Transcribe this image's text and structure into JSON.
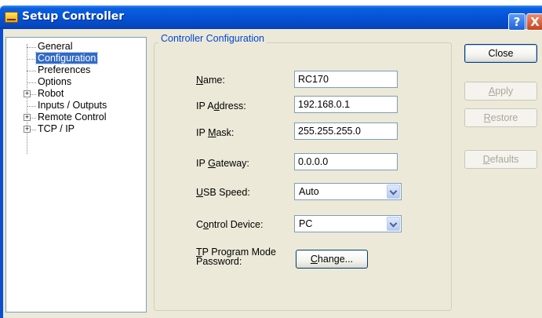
{
  "window": {
    "title": "Setup Controller",
    "help_glyph": "?",
    "close_glyph": "X"
  },
  "tree": {
    "items": [
      {
        "label": "General"
      },
      {
        "label": "Configuration",
        "selected": true
      },
      {
        "label": "Preferences"
      },
      {
        "label": "Options"
      },
      {
        "label": "Robot",
        "expandable": true
      },
      {
        "label": "Inputs / Outputs"
      },
      {
        "label": "Remote Control",
        "expandable": true
      },
      {
        "label": "TCP / IP",
        "expandable": true
      }
    ],
    "expander_glyph": "+"
  },
  "group": {
    "legend": "Controller Configuration"
  },
  "fields": {
    "name": {
      "label_pre": "",
      "label_key": "N",
      "label_post": "ame:",
      "value": "RC170"
    },
    "ip_address": {
      "label_pre": "IP A",
      "label_key": "d",
      "label_post": "dress:",
      "value": "192.168.0.1"
    },
    "ip_mask": {
      "label_pre": "IP ",
      "label_key": "M",
      "label_post": "ask:",
      "value": "255.255.255.0"
    },
    "ip_gateway": {
      "label_pre": "IP ",
      "label_key": "G",
      "label_post": "ateway:",
      "value": "0.0.0.0"
    },
    "usb_speed": {
      "label_pre": "",
      "label_key": "U",
      "label_post": "SB Speed:",
      "value": "Auto"
    },
    "control_device": {
      "label_pre": "C",
      "label_key": "o",
      "label_post": "ntrol Device:",
      "value": "PC"
    },
    "tp_password": {
      "label_line1_pre": "",
      "label_line1_key": "T",
      "label_line1_post": "P Program Mode",
      "label_line2": "Password:",
      "button_key": "C",
      "button_post": "hange..."
    }
  },
  "buttons": {
    "close": {
      "label": "Close"
    },
    "apply": {
      "key": "A",
      "post": "pply"
    },
    "restore": {
      "key": "R",
      "post": "estore"
    },
    "defaults": {
      "key": "D",
      "post": "efaults"
    }
  },
  "colors": {
    "title_blue": "#0553d6",
    "selection": "#316ac5",
    "legend_text": "#0046d5",
    "dialog_bg": "#ece9d8"
  }
}
